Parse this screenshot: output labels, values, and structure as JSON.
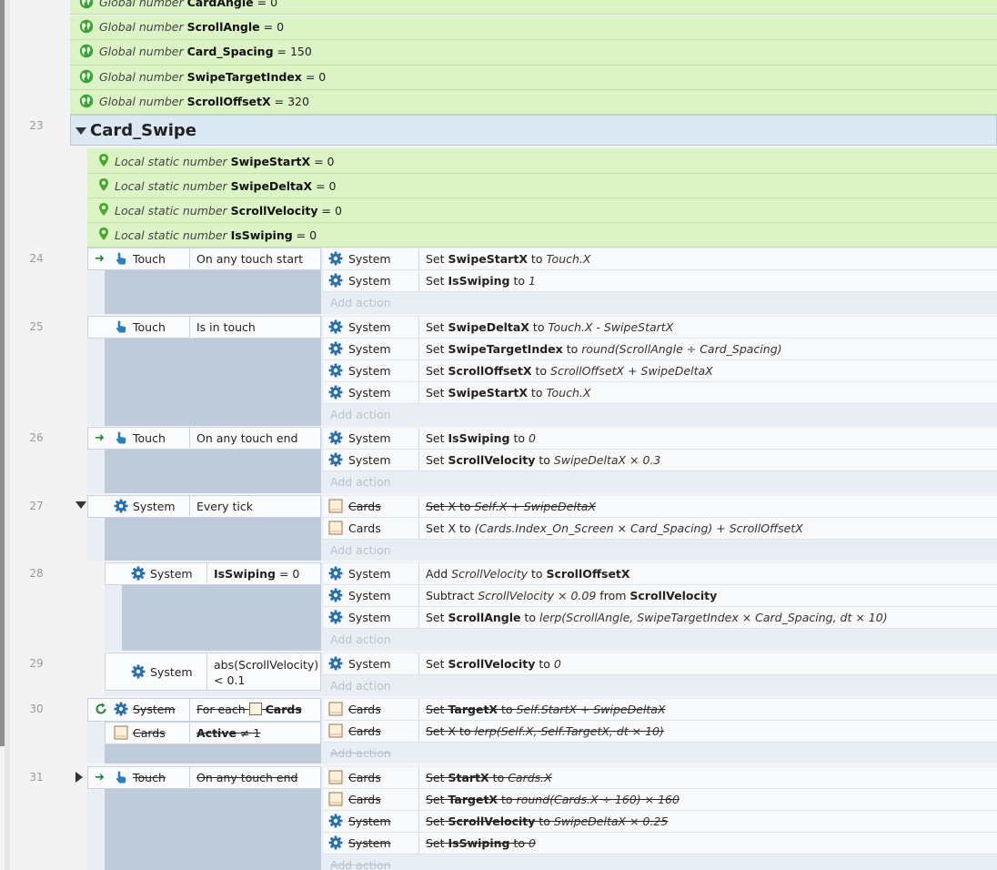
{
  "globals": [
    {
      "kind": "Global number",
      "name": "CardAngle",
      "value": "= 0"
    },
    {
      "kind": "Global number",
      "name": "ScrollAngle",
      "value": "= 0"
    },
    {
      "kind": "Global number",
      "name": "Card_Spacing",
      "value": "= 150"
    },
    {
      "kind": "Global number",
      "name": "SwipeTargetIndex",
      "value": "= 0"
    },
    {
      "kind": "Global number",
      "name": "ScrollOffsetX",
      "value": "= 320"
    }
  ],
  "group": {
    "line": "23",
    "name": "Card_Swipe"
  },
  "locals": [
    {
      "kind": "Local static number",
      "name": "SwipeStartX",
      "value": "= 0"
    },
    {
      "kind": "Local static number",
      "name": "SwipeDeltaX",
      "value": "= 0"
    },
    {
      "kind": "Local static number",
      "name": "ScrollVelocity",
      "value": "= 0"
    },
    {
      "kind": "Local static number",
      "name": "IsSwiping",
      "value": "= 0"
    }
  ],
  "add_action_label": "Add action",
  "events": {
    "e24": {
      "line": "24",
      "obj": "Touch",
      "cond": "On any touch start",
      "actions": [
        {
          "obj": "System",
          "pre": "Set ",
          "b1": "SwipeStartX",
          "mid": " to ",
          "i1": "Touch.X"
        },
        {
          "obj": "System",
          "pre": "Set ",
          "b1": "IsSwiping",
          "mid": " to ",
          "i1": "1"
        }
      ]
    },
    "e25": {
      "line": "25",
      "obj": "Touch",
      "cond": "Is in touch",
      "actions": [
        {
          "obj": "System",
          "pre": "Set ",
          "b1": "SwipeDeltaX",
          "mid": " to ",
          "i1": "Touch.X - SwipeStartX"
        },
        {
          "obj": "System",
          "pre": "Set ",
          "b1": "SwipeTargetIndex",
          "mid": " to ",
          "i1": "round(ScrollAngle ÷ Card_Spacing)"
        },
        {
          "obj": "System",
          "pre": "Set ",
          "b1": "ScrollOffsetX",
          "mid": " to ",
          "i1": "ScrollOffsetX + SwipeDeltaX"
        },
        {
          "obj": "System",
          "pre": "Set ",
          "b1": "SwipeStartX",
          "mid": " to ",
          "i1": "Touch.X"
        }
      ]
    },
    "e26": {
      "line": "26",
      "obj": "Touch",
      "cond": "On any touch end",
      "actions": [
        {
          "obj": "System",
          "pre": "Set ",
          "b1": "IsSwiping",
          "mid": " to ",
          "i1": "0"
        },
        {
          "obj": "System",
          "pre": "Set ",
          "b1": "ScrollVelocity",
          "mid": " to ",
          "i1": "SwipeDeltaX × 0.3"
        }
      ]
    },
    "e27": {
      "line": "27",
      "obj": "System",
      "cond": "Every tick",
      "actions": [
        {
          "obj": "Cards",
          "pre": "Set X to ",
          "i1": "Self.X + SwipeDeltaX",
          "disabled": true
        },
        {
          "obj": "Cards",
          "pre": "Set X to ",
          "i1": "(Cards.Index_On_Screen × Card_Spacing) + ScrollOffsetX"
        }
      ]
    },
    "e28": {
      "line": "28",
      "obj": "System",
      "cond_b": "IsSwiping",
      "cond_rest": " = 0",
      "actions": [
        {
          "obj": "System",
          "pre": "Add ",
          "i1": "ScrollVelocity ",
          "mid": " to ",
          "b1": "ScrollOffsetX"
        },
        {
          "obj": "System",
          "pre": "Subtract ",
          "i1": "ScrollVelocity × 0.09",
          "mid": "  from ",
          "b1": "ScrollVelocity"
        },
        {
          "obj": "System",
          "pre": "Set ",
          "b1": "ScrollAngle",
          "mid": " to ",
          "i1": "lerp(ScrollAngle, SwipeTargetIndex × Card_Spacing, dt × 10)"
        }
      ]
    },
    "e29": {
      "line": "29",
      "obj": "System",
      "cond1": "abs(ScrollVelocity)",
      "cond2": "< 0.1",
      "actions": [
        {
          "obj": "System",
          "pre": "Set ",
          "b1": "ScrollVelocity",
          "mid": " to ",
          "i1": "0"
        }
      ]
    },
    "e30": {
      "line": "30",
      "obj": "System",
      "cond_pre": "For each ",
      "cond_b": "Cards",
      "obj2": "Cards",
      "cond2_b": "Active",
      "cond2_rest": " ≠ 1",
      "actions": [
        {
          "obj": "Cards",
          "pre": "Set ",
          "b1": "TargetX",
          "mid": " to ",
          "i1": "Self.StartX + SwipeDeltaX"
        },
        {
          "obj": "Cards",
          "pre": "Set X to ",
          "i1": "lerp(Self.X, Self.TargetX, dt × 10)"
        }
      ]
    },
    "e31": {
      "line": "31",
      "obj": "Touch",
      "cond": "On any touch end",
      "actions": [
        {
          "obj": "Cards",
          "pre": "Set ",
          "b1": "StartX",
          "mid": " to ",
          "i1": "Cards.X"
        },
        {
          "obj": "Cards",
          "pre": "Set ",
          "b1": "TargetX",
          "mid": " to ",
          "i1": "round(Cards.X ÷ 160) × 160"
        },
        {
          "obj": "System",
          "pre": "Set ",
          "b1": "ScrollVelocity",
          "mid": " to ",
          "i1": "SwipeDeltaX × 0.25"
        },
        {
          "obj": "System",
          "pre": "Set ",
          "b1": "IsSwiping",
          "mid": " to ",
          "i1": "0"
        }
      ]
    }
  },
  "colors": {
    "variable_bg": "#dcf3c5",
    "event_bg": "#e9eef4",
    "condition_column": "#bfcbdb",
    "group_bg": "#dce9f5",
    "trigger_arrow": "#1b8a2e",
    "add_action": "#b8c3d0"
  },
  "icons": {
    "global": "globe-icon",
    "local": "pin-icon",
    "touch": "touch-hand-icon",
    "system": "gear-icon",
    "sprite": "sprite-icon",
    "trigger": "trigger-arrow-icon",
    "loop": "loop-icon"
  }
}
